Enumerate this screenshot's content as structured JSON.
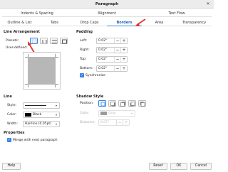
{
  "window": {
    "title": "Paragraph"
  },
  "tabs_row1": [
    "Indents & Spacing",
    "Alignment",
    "Text Flow"
  ],
  "tabs_row2": [
    "Outline & List",
    "Tabs",
    "Drop Caps",
    "Borders",
    "Area",
    "Transparency"
  ],
  "active_tab": "Borders",
  "line_arrangement": {
    "title": "Line Arrangement",
    "presets_label": "Presets:",
    "user_defined_label": "User-defined:"
  },
  "padding": {
    "title": "Padding",
    "left_label": "Left:",
    "left_value": "0.02\"",
    "right_label": "Right:",
    "right_value": "0.02\"",
    "top_label": "Top:",
    "top_value": "0.02\"",
    "bottom_label": "Bottom:",
    "bottom_value": "0.02\"",
    "synchronize_label": "Synchronize",
    "synchronize_checked": true
  },
  "line": {
    "title": "Line",
    "style_label": "Style:",
    "color_label": "Color:",
    "color_value": "Black",
    "color_hex": "#000000",
    "width_label": "Width:",
    "width_value": "Hairline (0.05pt)"
  },
  "shadow_style": {
    "title": "Shadow Style",
    "position_label": "Position:",
    "color_label": "Color:",
    "color_value": "Gray",
    "color_hex": "#808080",
    "distance_label": "Distance:",
    "distance_value": "0.07\""
  },
  "properties": {
    "title": "Properties",
    "merge_label": "Merge with next paragraph",
    "merge_checked": true
  },
  "footer": {
    "help": "Help",
    "reset": "Reset",
    "ok": "OK",
    "cancel": "Cancel"
  },
  "colors": {
    "accent": "#3584e4",
    "annotation_arrow": "#e0392b"
  },
  "icons": {
    "minus": "−",
    "plus": "+",
    "chevron": "▾",
    "check": "✓",
    "close": "✕"
  }
}
